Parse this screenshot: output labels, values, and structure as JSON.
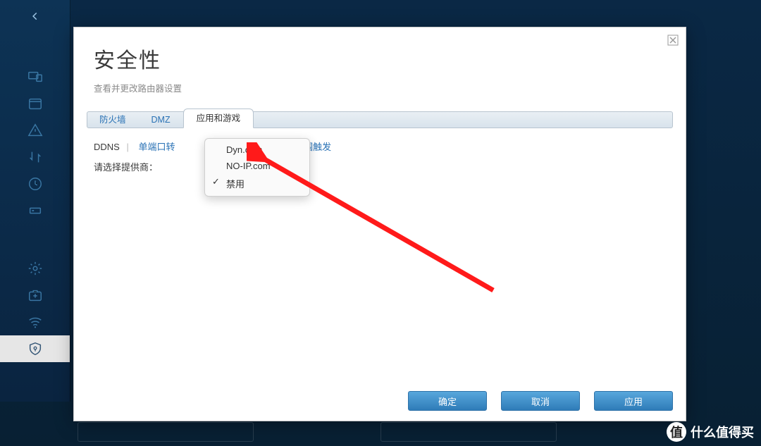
{
  "page": {
    "title": "安全性",
    "subtitle": "查看并更改路由器设置"
  },
  "tabs": {
    "firewall": "防火墙",
    "dmz": "DMZ",
    "apps": "应用和游戏"
  },
  "subnav": {
    "ddns": "DDNS",
    "single_port": "单端口转",
    "range_trigger": "端口范围触发"
  },
  "provider_label": "请选择提供商：",
  "dropdown": {
    "opt1": "Dyn.com",
    "opt2": "NO-IP.com",
    "opt3": "禁用"
  },
  "buttons": {
    "ok": "确定",
    "cancel": "取消",
    "apply": "应用"
  },
  "watermark": {
    "badge": "值",
    "text": "什么值得买"
  }
}
